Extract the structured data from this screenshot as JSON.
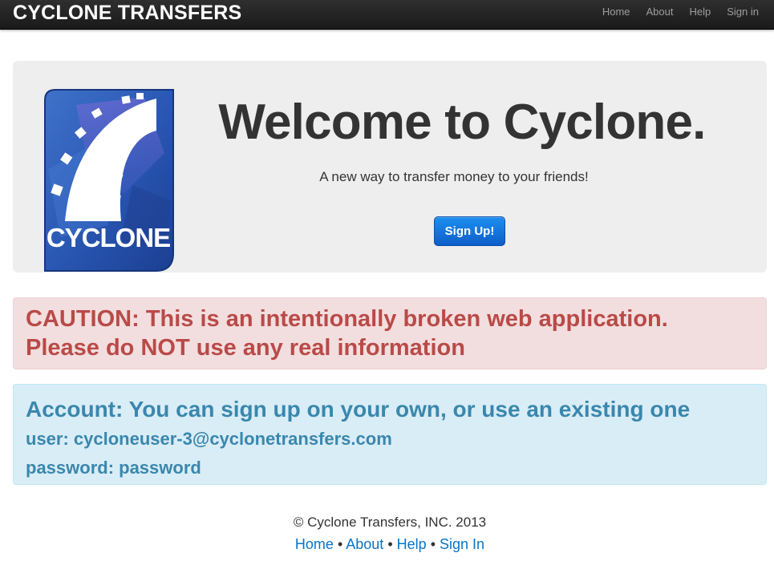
{
  "navbar": {
    "brand": "CYCLONE TRANSFERS",
    "links": [
      "Home",
      "About",
      "Help",
      "Sign in"
    ]
  },
  "hero": {
    "logo_text": "CYCLONE",
    "title": "Welcome to Cyclone.",
    "subtitle": "A new way to transfer money to your friends!",
    "signup_label": "Sign Up!"
  },
  "caution": {
    "line1": "CAUTION: This is an intentionally broken web application.",
    "line2": "Please do NOT use any real information"
  },
  "account": {
    "heading": "Account: You can sign up on your own, or use an existing one",
    "user": "user: cycloneuser-3@cyclonetransfers.com",
    "password": "password: password"
  },
  "footer": {
    "copyright": "© Cyclone Transfers, INC. 2013",
    "links": [
      "Home",
      "About",
      "Help",
      "Sign In"
    ],
    "separator": "•"
  },
  "colors": {
    "navbar_bg": "#222222",
    "hero_bg": "#eeeeee",
    "primary_button": "#0e6fd9",
    "error_text": "#b94a48",
    "error_bg": "#f2dede",
    "info_text": "#3a87ad",
    "info_bg": "#d9edf7",
    "link": "#0a74c6"
  }
}
